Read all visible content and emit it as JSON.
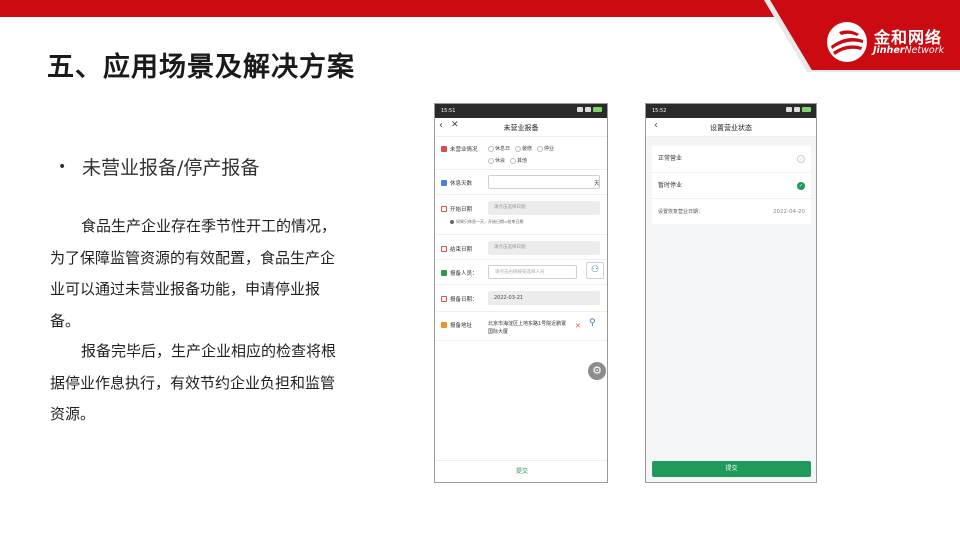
{
  "brand": {
    "name_cn": "金和网络",
    "name_en_bold": "Jinher",
    "name_en_light": "Network",
    "color": "#cc0a12"
  },
  "slide": {
    "title": "五、应用场景及解决方案",
    "bullet": "未营业报备/停产报备",
    "paragraph1": "食品生产企业存在季节性开工的情况，为了保障监管资源的有效配置，食品生产企业可以通过未营业报备功能，申请停业报备。",
    "paragraph2": "报备完毕后，生产企业相应的检查将根据停业作息执行，有效节约企业负担和监管资源。"
  },
  "phone1": {
    "status_time": "15:51",
    "title": "未营业报备",
    "fields": {
      "status_label": "未营业情况",
      "status_options": [
        "休息日",
        "装修",
        "停业",
        "休会",
        "其他"
      ],
      "rest_days_label": "休息天数",
      "rest_days_unit": "天",
      "start_date_label": "开始日期",
      "start_date_placeholder": "请点击选择日期",
      "hint": "如果只休息一天，开始日期=结束日期",
      "end_date_label": "结束日期",
      "end_date_placeholder": "请点击选择日期",
      "reporter_label": "报备人员：",
      "reporter_placeholder": "请点击右侧按钮选择人员",
      "report_date_label": "报备日期：",
      "report_date_value": "2022-03-21",
      "address_label": "报备地址",
      "address_value": "北京市海淀区上地东路1号院近鹏寰国际大厦"
    },
    "submit": "提交"
  },
  "phone2": {
    "status_time": "15:52",
    "title": "设置营业状态",
    "options": [
      {
        "label": "正常营业",
        "selected": false
      },
      {
        "label": "暂时停业",
        "selected": true
      }
    ],
    "resume_date_label": "设置恢复营业日期：",
    "resume_date_value": "2022-04-20",
    "submit": "提交",
    "accent": "#1f9a5a"
  }
}
